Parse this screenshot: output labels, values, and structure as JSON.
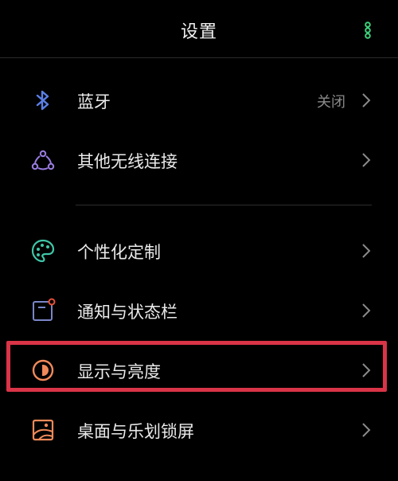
{
  "header": {
    "title": "设置"
  },
  "items": [
    {
      "label": "蓝牙",
      "value": "关闭",
      "icon": "bluetooth-icon"
    },
    {
      "label": "其他无线连接",
      "icon": "wireless-connection-icon"
    },
    {
      "label": "个性化定制",
      "icon": "palette-icon"
    },
    {
      "label": "通知与状态栏",
      "icon": "notification-icon"
    },
    {
      "label": "显示与亮度",
      "icon": "brightness-icon"
    },
    {
      "label": "桌面与乐划锁屏",
      "icon": "wallpaper-icon"
    }
  ],
  "colors": {
    "background": "#000000",
    "accent_green": "#3fd07a",
    "highlight_red": "#d93447",
    "bluetooth_blue": "#5b7fe6",
    "brightness_orange": "#f08a5a"
  }
}
